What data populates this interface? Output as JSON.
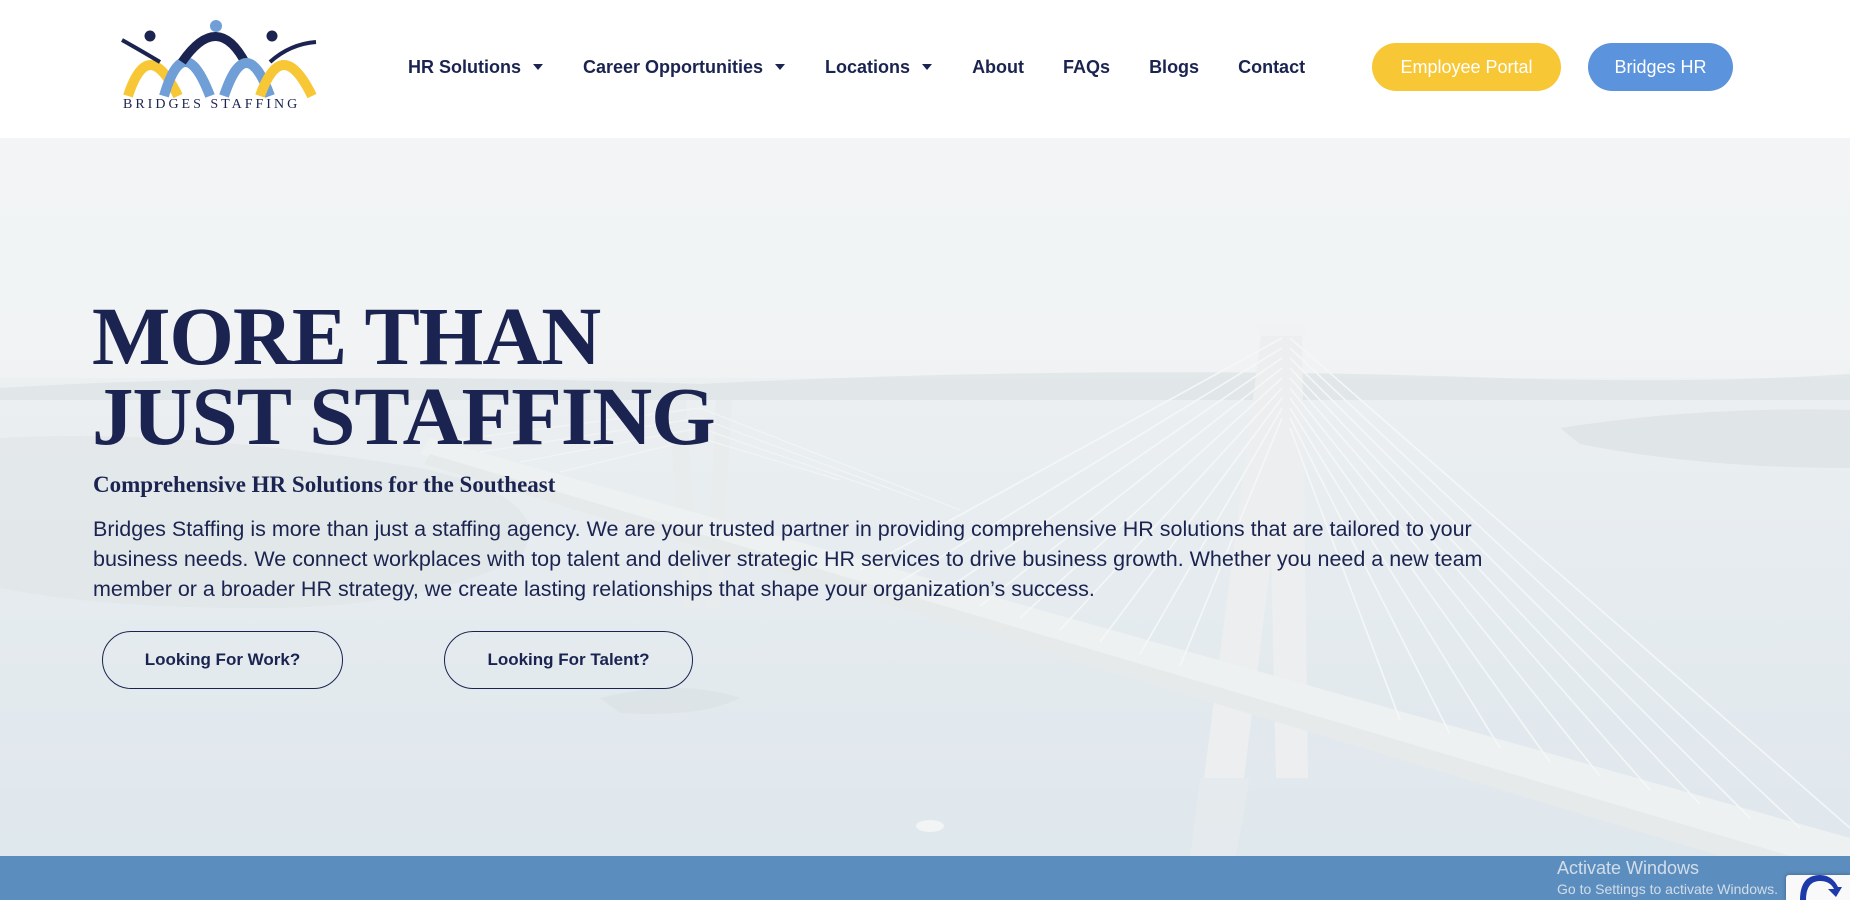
{
  "brand": {
    "name": "BRIDGES STAFFING",
    "colors": {
      "navy": "#1b2450",
      "yellow": "#f7c736",
      "blue": "#5b93dc",
      "band": "#5b8dbe"
    }
  },
  "nav": {
    "items": [
      {
        "label": "HR Solutions",
        "has_dropdown": true
      },
      {
        "label": "Career Opportunities",
        "has_dropdown": true
      },
      {
        "label": "Locations",
        "has_dropdown": true
      },
      {
        "label": "About",
        "has_dropdown": false
      },
      {
        "label": "FAQs",
        "has_dropdown": false
      },
      {
        "label": "Blogs",
        "has_dropdown": false
      },
      {
        "label": "Contact",
        "has_dropdown": false
      }
    ],
    "employee_portal_label": "Employee Portal",
    "bridges_hr_label": "Bridges HR"
  },
  "hero": {
    "title_line1": "MORE THAN",
    "title_line2": "JUST STAFFING",
    "subtitle": "Comprehensive HR Solutions for the Southeast",
    "body": "Bridges Staffing is more than just a staffing agency. We are your trusted partner in providing comprehensive HR solutions that are tailored to your business needs. We connect workplaces with top talent and deliver strategic HR services to drive business growth. Whether you need a new team member or a broader HR strategy, we create lasting relationships that shape your organization’s success.",
    "work_button_label": "Looking For Work?",
    "talent_button_label": "Looking For Talent?"
  },
  "os_overlay": {
    "activate_title": "Activate Windows",
    "activate_hint": "Go to Settings to activate Windows."
  },
  "icons": [
    "dropdown-caret-icon",
    "bridges-logo-icon",
    "recaptcha-icon"
  ]
}
